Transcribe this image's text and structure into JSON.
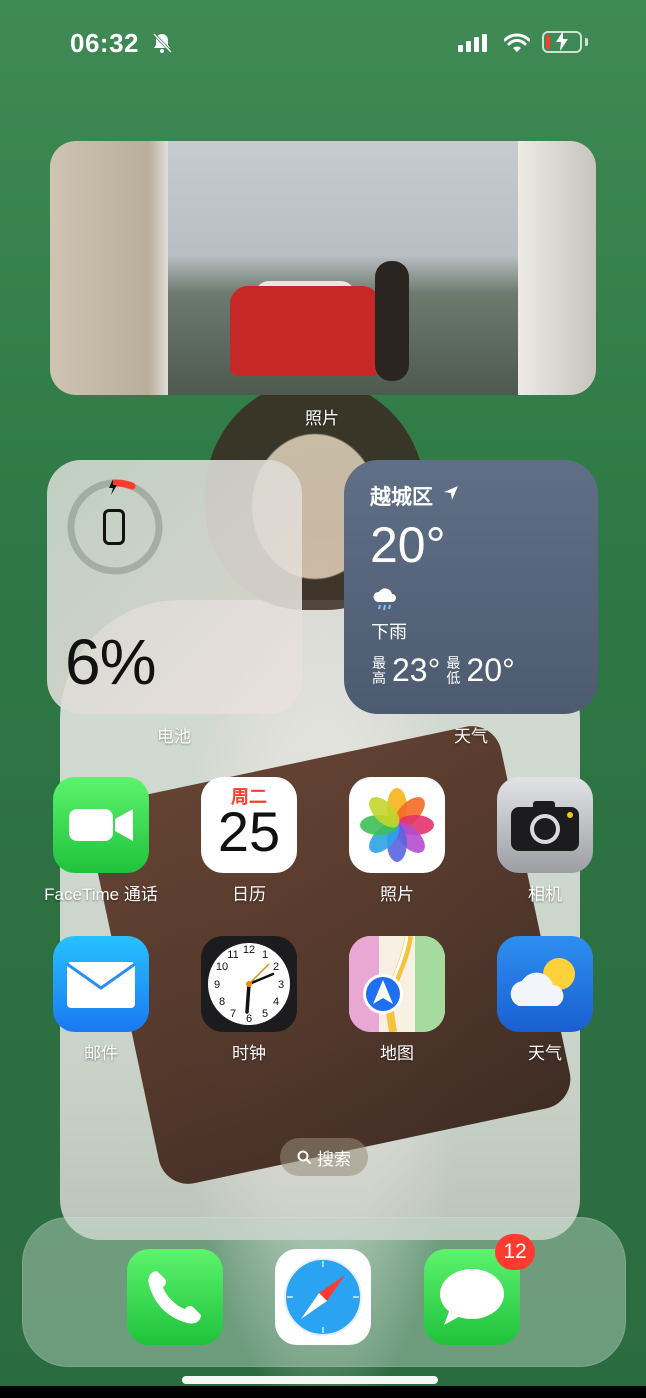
{
  "status_bar": {
    "time": "06:32",
    "icons": [
      "bell-slash-icon",
      "signal-icon",
      "wifi-icon",
      "battery-charging-icon"
    ],
    "battery_color": "#ff3b30"
  },
  "widgets": {
    "photos": {
      "label": "照片"
    },
    "battery": {
      "label": "电池",
      "percent_text": "6%",
      "percent_value": 6
    },
    "weather": {
      "label": "天气",
      "city": "越城区",
      "temperature": "20°",
      "condition": "下雨",
      "high_label": "最高",
      "high_temp": "23°",
      "low_label": "最低",
      "low_temp": "20°"
    }
  },
  "apps": [
    {
      "id": "facetime",
      "label": "FaceTime 通话",
      "icon": "video-camera-icon"
    },
    {
      "id": "calendar",
      "label": "日历",
      "icon": "calendar-icon",
      "weekday": "周二",
      "date": "25"
    },
    {
      "id": "photos",
      "label": "照片",
      "icon": "photos-flower-icon"
    },
    {
      "id": "camera",
      "label": "相机",
      "icon": "camera-icon"
    },
    {
      "id": "mail",
      "label": "邮件",
      "icon": "envelope-icon"
    },
    {
      "id": "clock",
      "label": "时钟",
      "icon": "clock-icon"
    },
    {
      "id": "maps",
      "label": "地图",
      "icon": "map-arrow-icon"
    },
    {
      "id": "weather",
      "label": "天气",
      "icon": "sun-cloud-icon"
    }
  ],
  "search": {
    "label": "搜索"
  },
  "dock": [
    {
      "id": "phone",
      "icon": "phone-handset-icon"
    },
    {
      "id": "safari",
      "icon": "compass-icon"
    },
    {
      "id": "messages",
      "icon": "speech-bubble-icon",
      "badge": "12"
    }
  ]
}
